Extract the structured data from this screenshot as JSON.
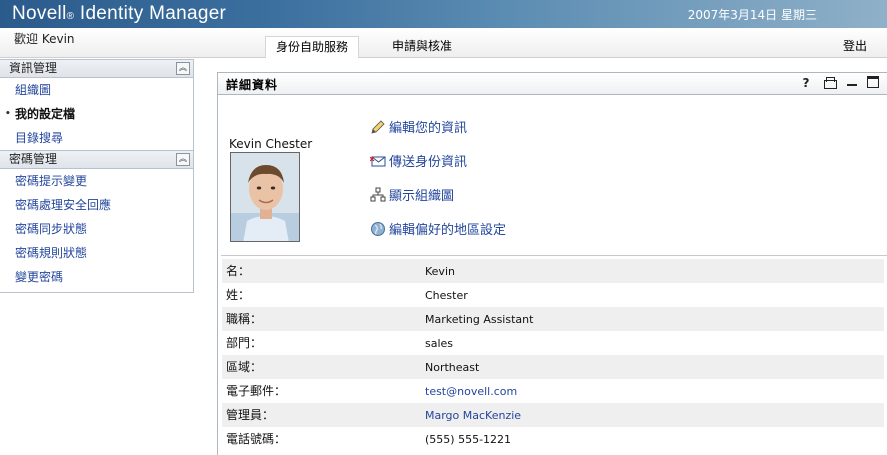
{
  "app": {
    "brand": "Novell",
    "brand_reg": "®",
    "brand_product": " Identity Manager"
  },
  "header": {
    "date": "2007年3月14日  星期三"
  },
  "nav": {
    "welcome": "歡迎  Kevin",
    "tabs": [
      {
        "label": "身份自助服務",
        "active": true
      },
      {
        "label": "申請與核准",
        "active": false
      }
    ],
    "logout": "登出"
  },
  "sidebar": {
    "groups": [
      {
        "title": "資訊管理",
        "items": [
          "組織圖",
          "我的設定檔",
          "目錄搜尋"
        ],
        "selected": "我的設定檔"
      },
      {
        "title": "密碼管理",
        "items": [
          "密碼提示變更",
          "密碼處理安全回應",
          "密碼同步狀態",
          "密碼規則狀態",
          "變更密碼"
        ]
      }
    ]
  },
  "portlet": {
    "title": "詳細資料",
    "toolbar": {
      "help": "?"
    },
    "profile_name": "Kevin Chester",
    "actions": [
      {
        "label": "編輯您的資訊",
        "icon": "pencil-icon"
      },
      {
        "label": "傳送身份資訊",
        "icon": "envelope-icon"
      },
      {
        "label": "顯示組織圖",
        "icon": "org-chart-icon"
      },
      {
        "label": "編輯偏好的地區設定",
        "icon": "globe-icon"
      }
    ],
    "details": [
      {
        "label": "名：",
        "value": "Kevin"
      },
      {
        "label": "姓：",
        "value": "Chester"
      },
      {
        "label": "職稱：",
        "value": "Marketing Assistant"
      },
      {
        "label": "部門：",
        "value": "sales"
      },
      {
        "label": "區域：",
        "value": "Northeast"
      },
      {
        "label": "電子郵件：",
        "value": "test@novell.com",
        "link": true
      },
      {
        "label": "管理員：",
        "value": "Margo MacKenzie",
        "link": true
      },
      {
        "label": "電話號碼：",
        "value": "(555) 555-1221"
      }
    ]
  },
  "colors": {
    "link": "#23469c",
    "banner": "#2b5b8c",
    "row_alt": "#efefef"
  }
}
